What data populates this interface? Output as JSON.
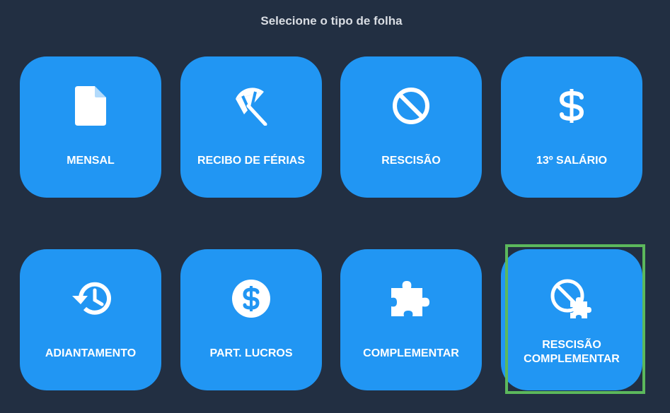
{
  "header": {
    "title": "Selecione o tipo de folha"
  },
  "cards": [
    {
      "label": "MENSAL",
      "icon": "file-icon"
    },
    {
      "label": "RECIBO DE FÉRIAS",
      "icon": "beach-umbrella-icon"
    },
    {
      "label": "RESCISÃO",
      "icon": "ban-icon"
    },
    {
      "label": "13º SALÁRIO",
      "icon": "dollar-icon"
    },
    {
      "label": "ADIANTAMENTO",
      "icon": "history-icon"
    },
    {
      "label": "PART. LUCROS",
      "icon": "dollar-circle-icon"
    },
    {
      "label": "COMPLEMENTAR",
      "icon": "puzzle-icon"
    },
    {
      "label_line1": "RESCISÃO",
      "label_line2": "COMPLEMENTAR",
      "icon": "ban-puzzle-icon"
    }
  ],
  "colors": {
    "background": "#222f42",
    "card": "#2196f3",
    "highlight": "#5cb85c",
    "title_text": "#d9dde3"
  }
}
